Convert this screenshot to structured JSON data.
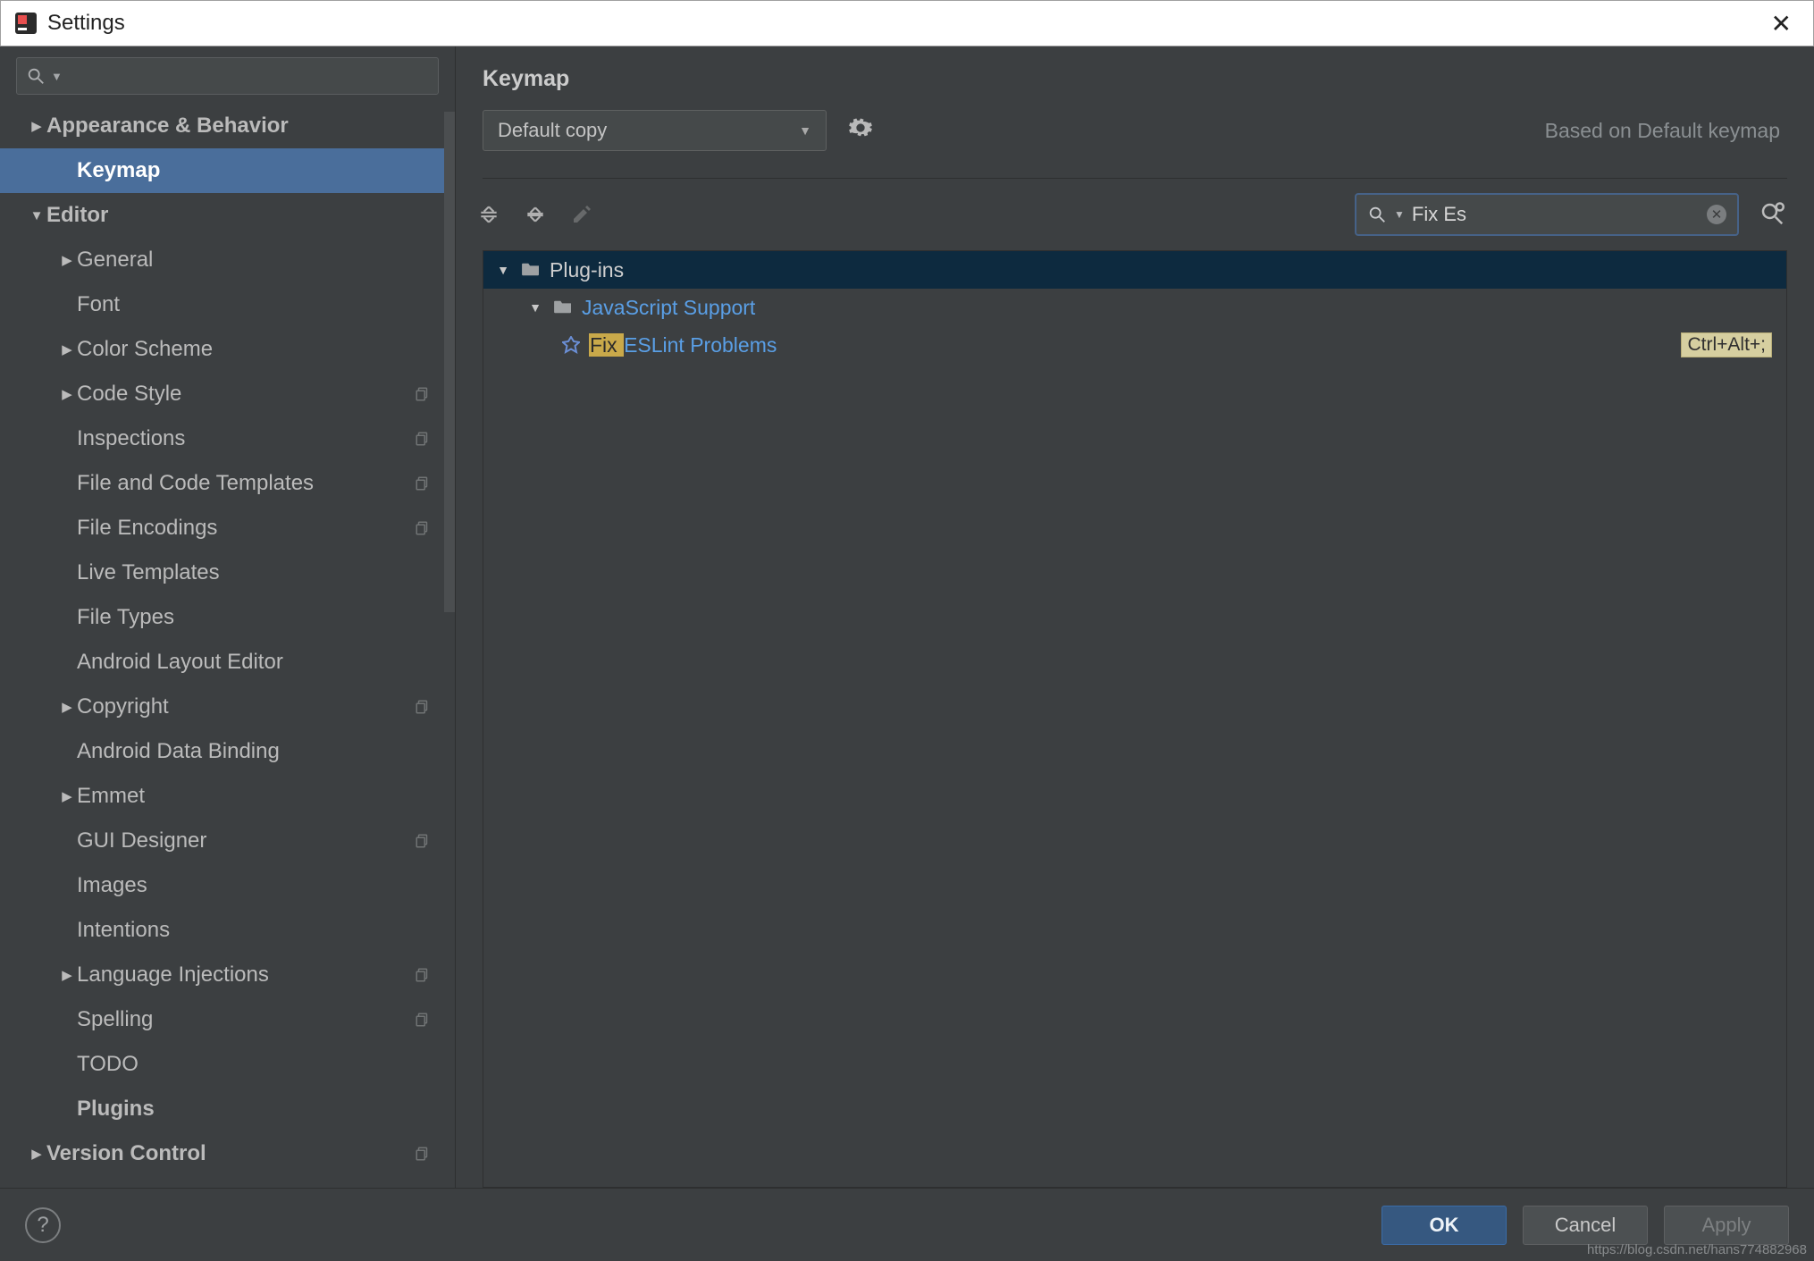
{
  "window": {
    "title": "Settings"
  },
  "sidebar": {
    "search_placeholder": "",
    "items": [
      {
        "label": "Appearance & Behavior",
        "bold": true,
        "arrow": "right",
        "level": 0
      },
      {
        "label": "Keymap",
        "bold": true,
        "arrow": "",
        "level": 1,
        "selected": true
      },
      {
        "label": "Editor",
        "bold": true,
        "arrow": "down",
        "level": 0
      },
      {
        "label": "General",
        "arrow": "right",
        "level": 1
      },
      {
        "label": "Font",
        "arrow": "",
        "level": 1
      },
      {
        "label": "Color Scheme",
        "arrow": "right",
        "level": 1
      },
      {
        "label": "Code Style",
        "arrow": "right",
        "level": 1,
        "copy": true
      },
      {
        "label": "Inspections",
        "arrow": "",
        "level": 1,
        "copy": true
      },
      {
        "label": "File and Code Templates",
        "arrow": "",
        "level": 1,
        "copy": true
      },
      {
        "label": "File Encodings",
        "arrow": "",
        "level": 1,
        "copy": true
      },
      {
        "label": "Live Templates",
        "arrow": "",
        "level": 1
      },
      {
        "label": "File Types",
        "arrow": "",
        "level": 1
      },
      {
        "label": "Android Layout Editor",
        "arrow": "",
        "level": 1
      },
      {
        "label": "Copyright",
        "arrow": "right",
        "level": 1,
        "copy": true
      },
      {
        "label": "Android Data Binding",
        "arrow": "",
        "level": 1
      },
      {
        "label": "Emmet",
        "arrow": "right",
        "level": 1
      },
      {
        "label": "GUI Designer",
        "arrow": "",
        "level": 1,
        "copy": true
      },
      {
        "label": "Images",
        "arrow": "",
        "level": 1
      },
      {
        "label": "Intentions",
        "arrow": "",
        "level": 1
      },
      {
        "label": "Language Injections",
        "arrow": "right",
        "level": 1,
        "copy": true
      },
      {
        "label": "Spelling",
        "arrow": "",
        "level": 1,
        "copy": true
      },
      {
        "label": "TODO",
        "arrow": "",
        "level": 1
      },
      {
        "label": "Plugins",
        "bold": true,
        "arrow": "",
        "level": 1
      },
      {
        "label": "Version Control",
        "bold": true,
        "arrow": "right",
        "level": 0,
        "copy": true
      }
    ]
  },
  "main": {
    "title": "Keymap",
    "combo_value": "Default copy",
    "based_on": "Based on Default keymap",
    "search_value": "Fix Es",
    "search_highlight": "Fix Es"
  },
  "results": [
    {
      "type": "folder",
      "label": "Plug-ins",
      "level": 0,
      "selected": true
    },
    {
      "type": "folder-link",
      "label": "JavaScript Support",
      "level": 1
    },
    {
      "type": "action",
      "hl": "Fix ",
      "rest": "ESLint Problems",
      "level": 2,
      "shortcut": "Ctrl+Alt+;"
    }
  ],
  "footer": {
    "ok": "OK",
    "cancel": "Cancel",
    "apply": "Apply",
    "help": "?"
  },
  "watermark": "https://blog.csdn.net/hans774882968"
}
